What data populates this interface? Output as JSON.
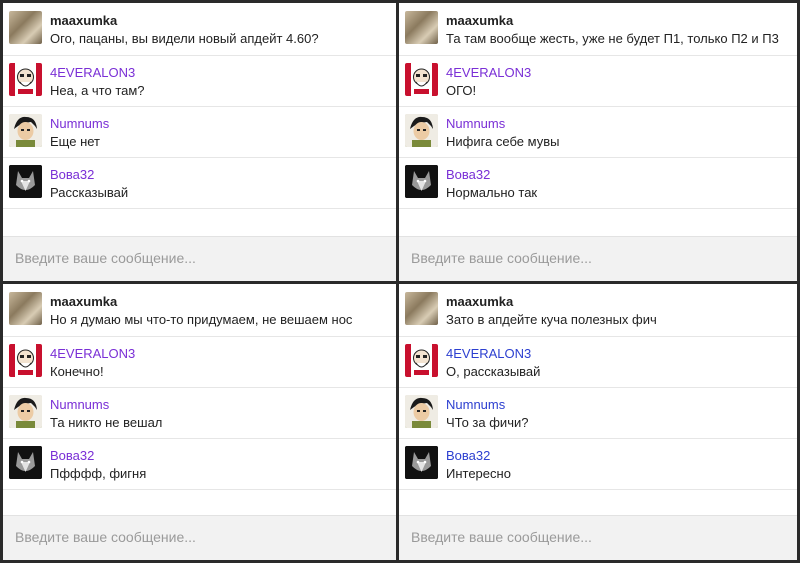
{
  "input_placeholder": "Введите ваше сообщение...",
  "colors": {
    "author_default": "#7a2fd6",
    "author_vova_bottom_right": "#2c3fd0",
    "author_first": "#222222",
    "panel_bg": "#ffffff",
    "input_bg": "#f2f2f2"
  },
  "panels": [
    {
      "messages": [
        {
          "author": "maaxumka",
          "avatar": "maaxumka-avatar",
          "text": "Ого, пацаны, вы видели новый апдейт 4.60?"
        },
        {
          "author": "4EVERALON3",
          "avatar": "kfc-avatar",
          "text": "Неа, а что там?"
        },
        {
          "author": "Numnums",
          "avatar": "anime-avatar",
          "text": "Еще нет"
        },
        {
          "author": "Вова32",
          "avatar": "wolf-avatar",
          "text": "Рассказывай"
        }
      ]
    },
    {
      "messages": [
        {
          "author": "maaxumka",
          "avatar": "maaxumka-avatar",
          "text": "Та там вообще жесть, уже не будет П1, только П2 и П3"
        },
        {
          "author": "4EVERALON3",
          "avatar": "kfc-avatar",
          "text": "ОГО!"
        },
        {
          "author": "Numnums",
          "avatar": "anime-avatar",
          "text": "Нифига себе мувы"
        },
        {
          "author": "Вова32",
          "avatar": "wolf-avatar",
          "text": "Нормально так"
        }
      ]
    },
    {
      "messages": [
        {
          "author": "maaxumka",
          "avatar": "maaxumka-avatar",
          "text": "Но я думаю мы что-то придумаем, не вешаем нос"
        },
        {
          "author": "4EVERALON3",
          "avatar": "kfc-avatar",
          "text": "Конечно!"
        },
        {
          "author": "Numnums",
          "avatar": "anime-avatar",
          "text": "Та никто не вешал"
        },
        {
          "author": "Вова32",
          "avatar": "wolf-avatar",
          "text": "Пфффф, фигня"
        }
      ]
    },
    {
      "messages": [
        {
          "author": "maaxumka",
          "avatar": "maaxumka-avatar",
          "text": "Зато в апдейте куча полезных фич"
        },
        {
          "author": "4EVERALON3",
          "avatar": "kfc-avatar",
          "text": "О, рассказывай"
        },
        {
          "author": "Numnums",
          "avatar": "anime-avatar",
          "text": "ЧТо за фичи?"
        },
        {
          "author": "Вова32",
          "avatar": "wolf-avatar",
          "text": "Интересно"
        }
      ]
    }
  ]
}
